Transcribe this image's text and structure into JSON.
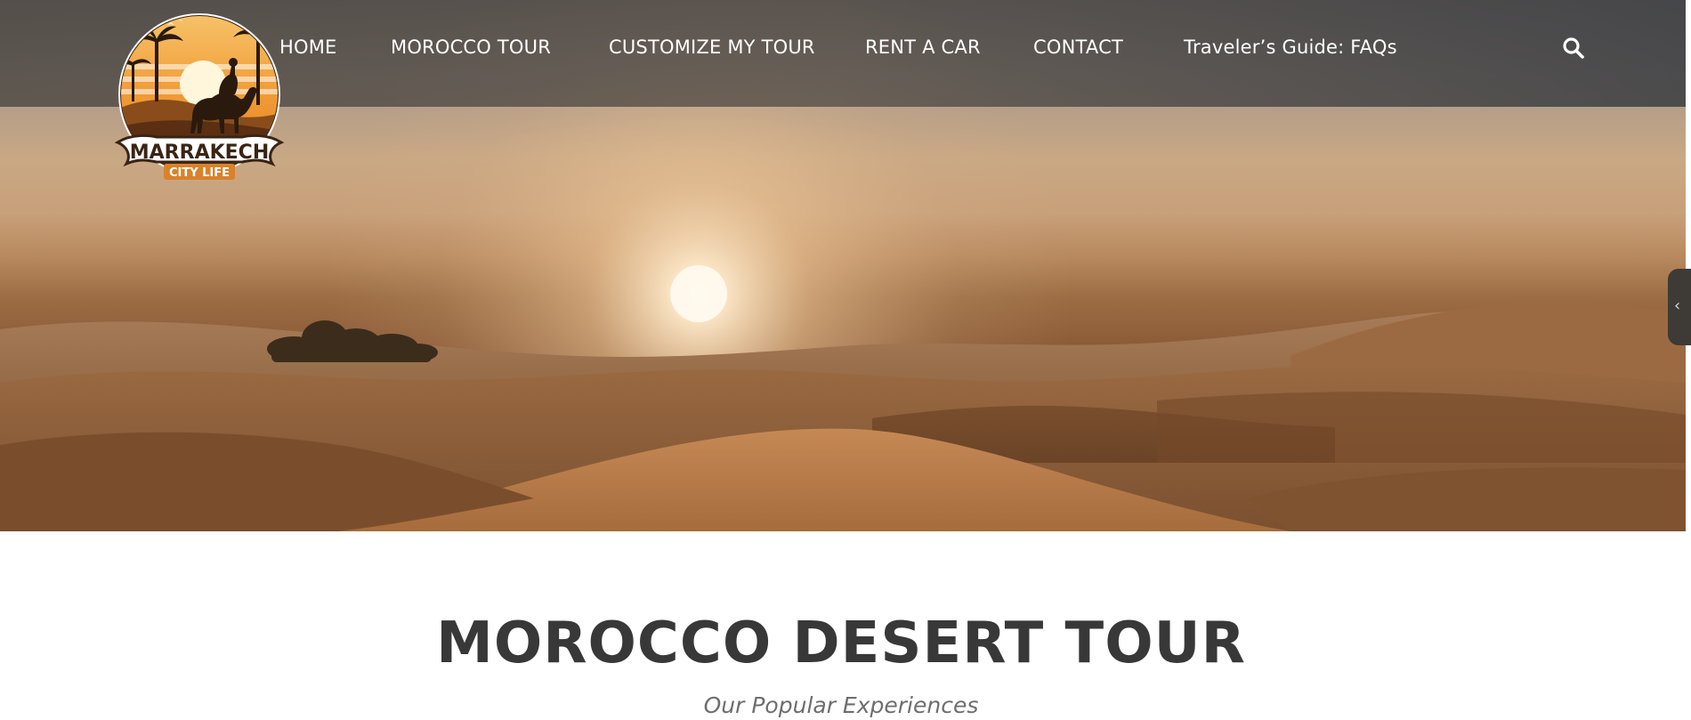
{
  "nav": {
    "items": [
      {
        "label": "HOME"
      },
      {
        "label": "MOROCCO TOUR"
      },
      {
        "label": "CUSTOMIZE MY TOUR"
      },
      {
        "label": "RENT A CAR"
      },
      {
        "label": "CONTACT"
      },
      {
        "label": "Traveler’s Guide: FAQs"
      }
    ],
    "search_icon": "search-icon"
  },
  "logo": {
    "name": "MARRAKECH",
    "tagline": "CITY LIFE"
  },
  "side_tab": {
    "icon": "chevron-left-icon",
    "glyph": "‹"
  },
  "main": {
    "heading": "MOROCCO DESERT TOUR",
    "subheading": "Our Popular Experiences"
  },
  "colors": {
    "heading": "#383838",
    "subheading": "#6e6e6e",
    "logo_orange": "#d9822b",
    "logo_dark": "#3a2414"
  }
}
